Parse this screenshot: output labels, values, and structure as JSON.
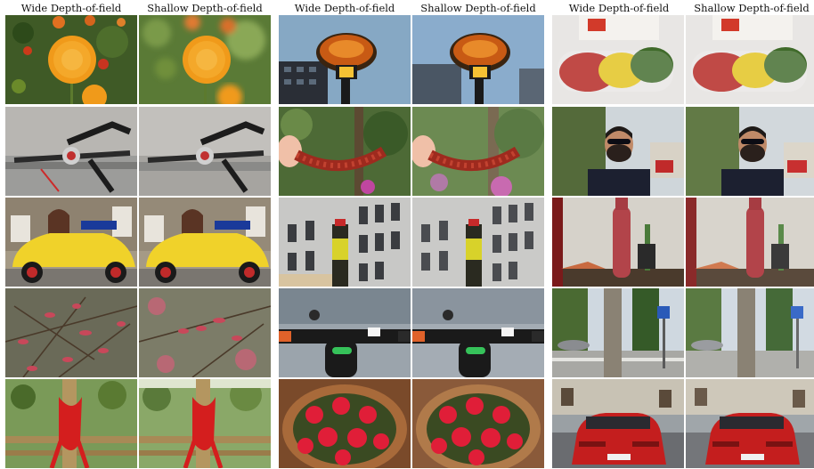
{
  "headers": [
    "Wide Depth-of-field",
    "Shallow Depth-of-field",
    "Wide Depth-of-field",
    "Shallow Depth-of-field",
    "Wide Depth-of-field",
    "Shallow Depth-of-field"
  ],
  "scenes": [
    [
      "orange-flowers",
      "street-lamp",
      "packaged-vegetables"
    ],
    [
      "bicycle-handlebar",
      "red-flexible-object",
      "man-with-sunglasses"
    ],
    [
      "yellow-beetle-taxi",
      "building-with-bottle",
      "red-water-bottle"
    ],
    [
      "red-leaves-branch",
      "scooter-handlebar",
      "tree-and-road-sign"
    ],
    [
      "red-rope-bamboo",
      "red-flowers-pot",
      "red-mustang"
    ]
  ],
  "colors": {
    "background": "#ffffff",
    "text": "#111111"
  }
}
